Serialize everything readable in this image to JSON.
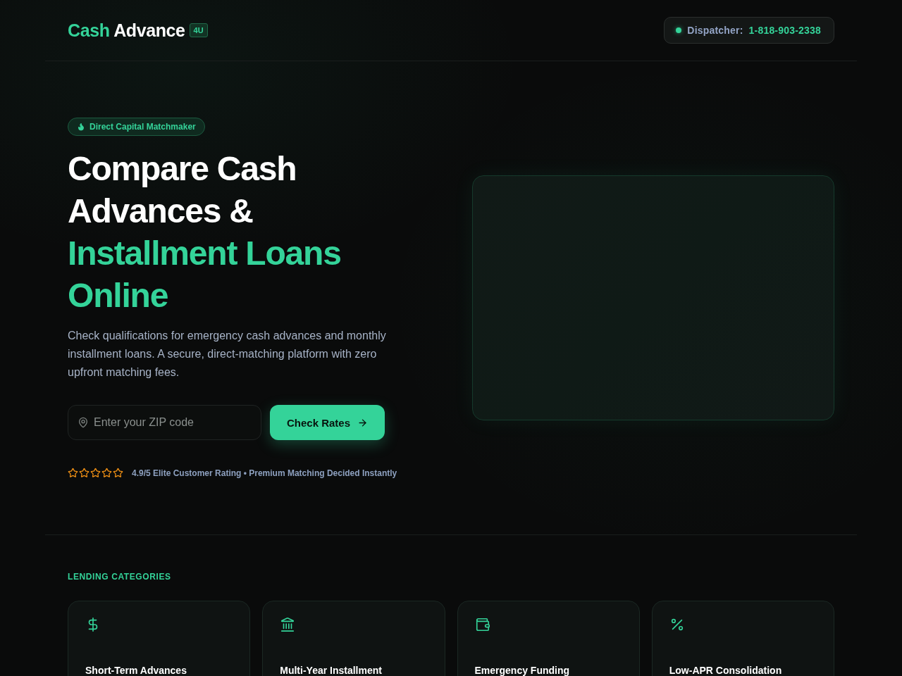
{
  "header": {
    "logo": {
      "primary": "Cash",
      "secondary": "Advance",
      "badge": "4U"
    },
    "contact": {
      "label": "Dispatcher:",
      "phone": "1-818-903-2338"
    }
  },
  "hero": {
    "badge": "Direct Capital Matchmaker",
    "title": [
      {
        "text": "Compare Cash Advances &",
        "accent": false
      },
      {
        "text": "Installment Loans Online",
        "accent": true
      }
    ],
    "description": "Check qualifications for emergency cash advances and monthly installment loans. A secure, direct-matching platform with zero upfront matching fees.",
    "zip_field": {
      "placeholder": "Enter your ZIP code"
    },
    "submit": {
      "label": "Check Rates"
    },
    "rating": {
      "stars": 0,
      "text": "4.9/5 Elite Customer Rating • Premium Matching Decided Instantly"
    }
  },
  "categories": {
    "heading": "LENDING CATEGORIES",
    "items": [
      {
        "kind": "dollar",
        "title": "Short-Term Advances"
      },
      {
        "kind": "bank",
        "title": "Multi-Year Installment"
      },
      {
        "kind": "wallet",
        "title": "Emergency Funding"
      },
      {
        "kind": "percent",
        "title": "Low-APR Consolidation"
      }
    ]
  }
}
